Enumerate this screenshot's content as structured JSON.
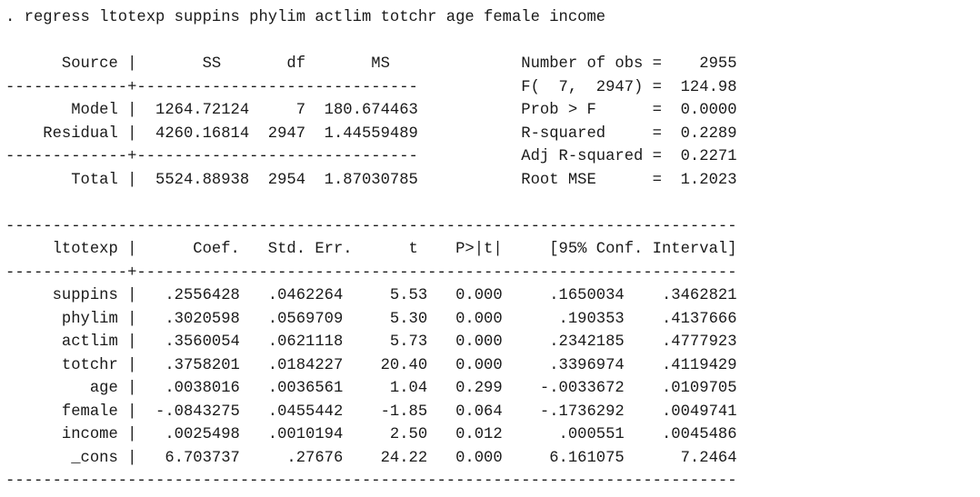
{
  "command": ". regress ltotexp suppins phylim actlim totchr age female income",
  "anova": {
    "header": "      Source |       SS       df       MS              Number of obs =    2955",
    "rule1": "-------------+------------------------------           F(  7,  2947) =  124.98",
    "model": "       Model |  1264.72124     7  180.674463           Prob > F      =  0.0000",
    "residual": "    Residual |  4260.16814  2947  1.44559489           R-squared     =  0.2289",
    "rule2": "-------------+------------------------------           Adj R-squared =  0.2271",
    "total": "       Total |  5524.88938  2954  1.87030785           Root MSE      =  1.2023"
  },
  "coef_table": {
    "top_rule": "------------------------------------------------------------------------------",
    "header": "     ltotexp |      Coef.   Std. Err.      t    P>|t|     [95% Conf. Interval]",
    "header_rule": "-------------+----------------------------------------------------------------",
    "rows": [
      "     suppins |   .2556428   .0462264     5.53   0.000     .1650034    .3462821",
      "      phylim |   .3020598   .0569709     5.30   0.000      .190353    .4137666",
      "      actlim |   .3560054   .0621118     5.73   0.000     .2342185    .4777923",
      "      totchr |   .3758201   .0184227    20.40   0.000     .3396974    .4119429",
      "         age |   .0038016   .0036561     1.04   0.299    -.0033672    .0109705",
      "      female |  -.0843275   .0455442    -1.85   0.064    -.1736292    .0049741",
      "      income |   .0025498   .0010194     2.50   0.012      .000551    .0045486",
      "       _cons |   6.703737     .27676    24.22   0.000     6.161075      7.2464"
    ],
    "bottom_rule": "------------------------------------------------------------------------------"
  }
}
